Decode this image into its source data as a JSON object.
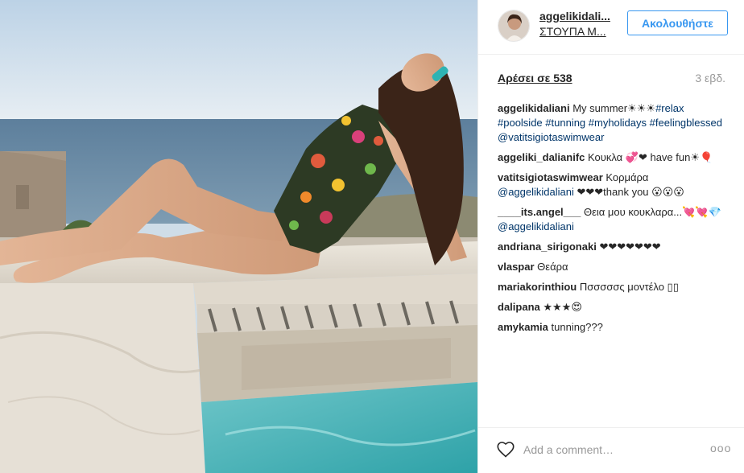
{
  "post": {
    "image_alt": "woman in floral swimsuit sitting by pool with sea view",
    "header": {
      "username": "aggelikidali...",
      "location": "ΣΤΟΥΠΑ Μ...",
      "follow_label": "Ακολουθήστε"
    },
    "likes_label": "Αρέσει σε 538",
    "time_ago": "3 εβδ.",
    "comments": [
      {
        "user": "aggelikidaliani",
        "text": " My summer☀☀☀",
        "tags": "#relax #poolside #tunning #myholidays #feelingblessed @vatitsigiotaswimwear"
      },
      {
        "user": "aggeliki_dalianifc",
        "text": " Κουκλα 💞❤ have fun☀🎈",
        "tags": ""
      },
      {
        "user": "vatitsigiotaswimwear",
        "text": " Κορμάρα ",
        "tags": "@aggelikidaliani",
        "text2": " ❤❤❤thank you 😮😮😮"
      },
      {
        "user": "____its.angel___",
        "text": " Θεια μου κουκλαρα...💘💘💎 ",
        "tags": "@aggelikidaliani"
      },
      {
        "user": "andriana_sirigonaki",
        "text": " ❤❤❤❤❤❤❤",
        "tags": ""
      },
      {
        "user": "vlaspar",
        "text": " Θεάρα",
        "tags": ""
      },
      {
        "user": "mariakorinthiou",
        "text": " Πσσσσσς μοντέλο ▯▯",
        "tags": ""
      },
      {
        "user": "dalipana",
        "text": " ★★★😍",
        "tags": ""
      },
      {
        "user": "amykamia",
        "text": " tunning???",
        "tags": ""
      }
    ],
    "footer": {
      "comment_placeholder": "Add a comment…",
      "more_label": "ooo"
    }
  },
  "icons": {
    "like": "heart-outline-icon",
    "more": "more-options-icon"
  },
  "colors": {
    "accent": "#3897f0",
    "tag": "#003569",
    "muted": "#999999",
    "border": "#efefef"
  }
}
